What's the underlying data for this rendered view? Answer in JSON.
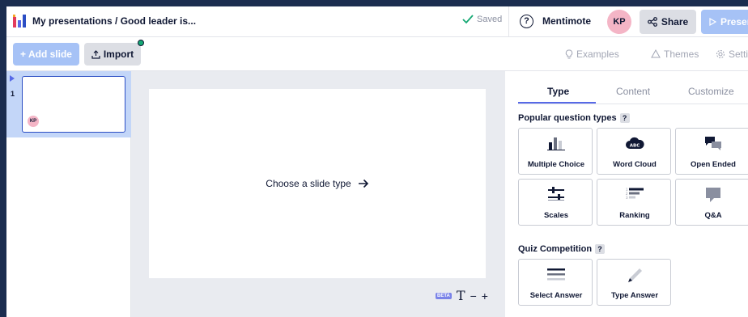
{
  "header": {
    "breadcrumb": "My presentations / Good leader is...",
    "saved_label": "Saved",
    "help_label": "?",
    "mentimote_label": "Mentimote",
    "avatar_initials": "KP",
    "share_label": "Share",
    "present_label": "Present"
  },
  "toolbar": {
    "add_slide_label": "+ Add slide",
    "import_label": "Import",
    "examples_label": "Examples",
    "themes_label": "Themes",
    "settings_label": "Settings"
  },
  "slides": [
    {
      "number": "1",
      "avatar_initials": "KP",
      "selected": true
    }
  ],
  "canvas": {
    "prompt": "Choose a slide type",
    "beta_label": "BETA",
    "text_tool_glyph": "T",
    "zoom_out_glyph": "−",
    "zoom_in_glyph": "+"
  },
  "panel": {
    "tabs": [
      {
        "label": "Type",
        "active": true
      },
      {
        "label": "Content",
        "active": false
      },
      {
        "label": "Customize",
        "active": false
      }
    ],
    "popular": {
      "title": "Popular question types",
      "help": "?",
      "cards": [
        {
          "label": "Multiple Choice",
          "icon": "bar-chart-icon"
        },
        {
          "label": "Word Cloud",
          "icon": "cloud-icon"
        },
        {
          "label": "Open Ended",
          "icon": "speech-bubbles-icon"
        },
        {
          "label": "Scales",
          "icon": "sliders-icon"
        },
        {
          "label": "Ranking",
          "icon": "ranking-icon"
        },
        {
          "label": "Q&A",
          "icon": "chat-bubble-icon"
        }
      ]
    },
    "quiz": {
      "title": "Quiz Competition",
      "help": "?",
      "cards": [
        {
          "label": "Select Answer",
          "icon": "lines-icon"
        },
        {
          "label": "Type Answer",
          "icon": "pencil-icon"
        }
      ]
    }
  },
  "colors": {
    "accent": "#5769e7",
    "primary_button": "#a6c2f6",
    "avatar": "#f4b5c6",
    "selected_slide": "#c3d6f8",
    "saved_check": "#14a873"
  }
}
